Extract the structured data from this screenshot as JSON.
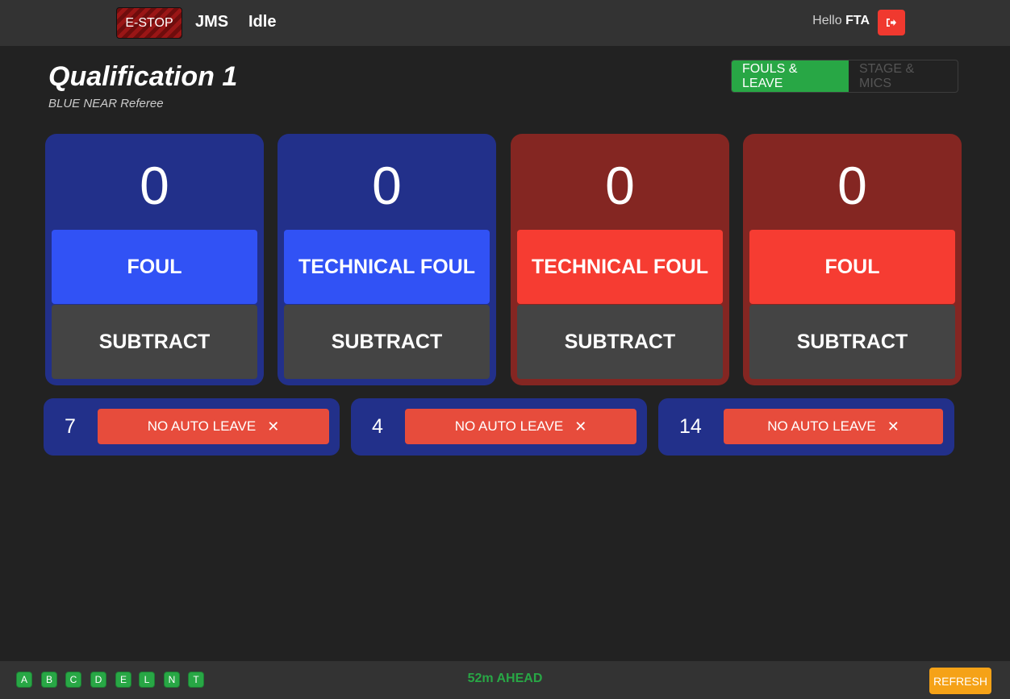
{
  "navbar": {
    "estop_label": "E-STOP",
    "brand": "JMS",
    "status": "Idle",
    "greeting": "Hello",
    "user": "FTA",
    "logout_icon": "sign-out-icon"
  },
  "header": {
    "title": "Qualification 1",
    "subtitle": "BLUE NEAR Referee",
    "tabs": [
      {
        "label": "FOULS & LEAVE",
        "active": true
      },
      {
        "label": "STAGE & MICS",
        "active": false
      }
    ]
  },
  "counters": [
    {
      "color": "blue",
      "count": "0",
      "action": "FOUL",
      "subtract": "SUBTRACT"
    },
    {
      "color": "blue",
      "count": "0",
      "action": "TECHNICAL FOUL",
      "subtract": "SUBTRACT"
    },
    {
      "color": "red",
      "count": "0",
      "action": "TECHNICAL FOUL",
      "subtract": "SUBTRACT"
    },
    {
      "color": "red",
      "count": "0",
      "action": "FOUL",
      "subtract": "SUBTRACT"
    }
  ],
  "leave": [
    {
      "team": "7",
      "label": "NO AUTO LEAVE",
      "icon": "close-icon"
    },
    {
      "team": "4",
      "label": "NO AUTO LEAVE",
      "icon": "close-icon"
    },
    {
      "team": "14",
      "label": "NO AUTO LEAVE",
      "icon": "close-icon"
    }
  ],
  "footer": {
    "badges": [
      "A",
      "B",
      "C",
      "D",
      "E",
      "L",
      "N",
      "T"
    ],
    "schedule_status": "52m AHEAD",
    "refresh_label": "REFRESH"
  },
  "colors": {
    "background": "#222222",
    "navbar": "#333333",
    "blue_card": "#22308a",
    "red_card": "#842622",
    "blue_button": "#3152f5",
    "red_button": "#f63c32",
    "subtract_button": "#444444",
    "leave_button": "#e74c3c",
    "success": "#28a745",
    "warning": "#f5a217"
  }
}
